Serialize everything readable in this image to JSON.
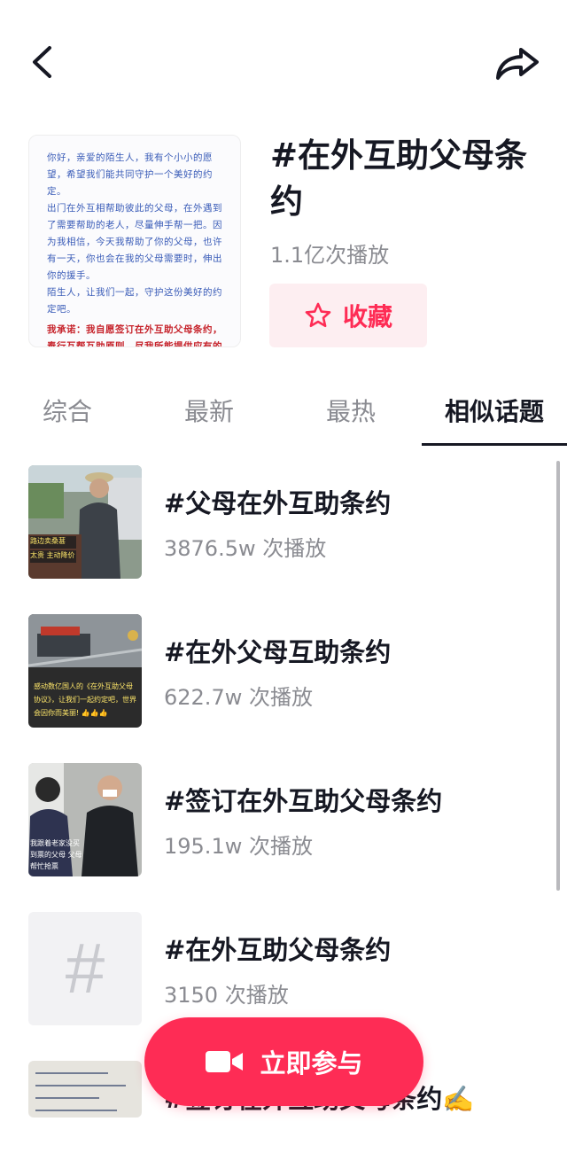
{
  "header": {
    "back_icon": "chevron-left-icon",
    "share_icon": "share-arrow-icon"
  },
  "topic": {
    "title": "#在外互助父母条约",
    "plays": "1.1亿次播放",
    "favorite_label": "收藏",
    "favorite_icon": "star-outline-icon",
    "accent_color": "#fe2c55",
    "cover_text": [
      "你好，亲爱的陌生人，我有个小小的愿望，希望我们能共同守护一个美好的约定。",
      "出门在外互相帮助彼此的父母，在外遇到了需要帮助的老人，尽量伸手帮一把。因为我相信，今天我帮助了你的父母，也许有一天，你也会在我的父母需要时，伸出你的援手。",
      "陌生人，让我们一起，守护这份美好的约定吧。"
    ],
    "cover_pledge": "我承诺：我自愿签订在外互助父母条约，奉行互帮互助原则，尽我所能提供应有的帮助和便利。"
  },
  "tabs": [
    {
      "label": "综合"
    },
    {
      "label": "最新"
    },
    {
      "label": "最热"
    },
    {
      "label": "相似话题"
    }
  ],
  "similar_topics": [
    {
      "title": "#父母在外互助条约",
      "plays": "3876.5w 次播放",
      "thumb_caption": "路边卖桑葚\n太贵 主动降价"
    },
    {
      "title": "#在外父母互助条约",
      "plays": "622.7w 次播放",
      "thumb_caption": "感动数亿国人的《在外互助父母协议》，让我们一起约定吧，世界会因你而美丽! 👍👍👍"
    },
    {
      "title": "#签订在外互助父母条约",
      "plays": "195.1w 次播放",
      "thumb_caption": "我跟着老家没买到票的父母 父母帮忙抢票"
    },
    {
      "title": "#在外互助父母条约",
      "plays": "3150 次播放",
      "thumb_caption": "#"
    },
    {
      "title": "#签订在外互助父母条约✍️",
      "plays": ""
    }
  ],
  "join_button": {
    "label": "立即参与",
    "icon": "video-camera-icon"
  }
}
